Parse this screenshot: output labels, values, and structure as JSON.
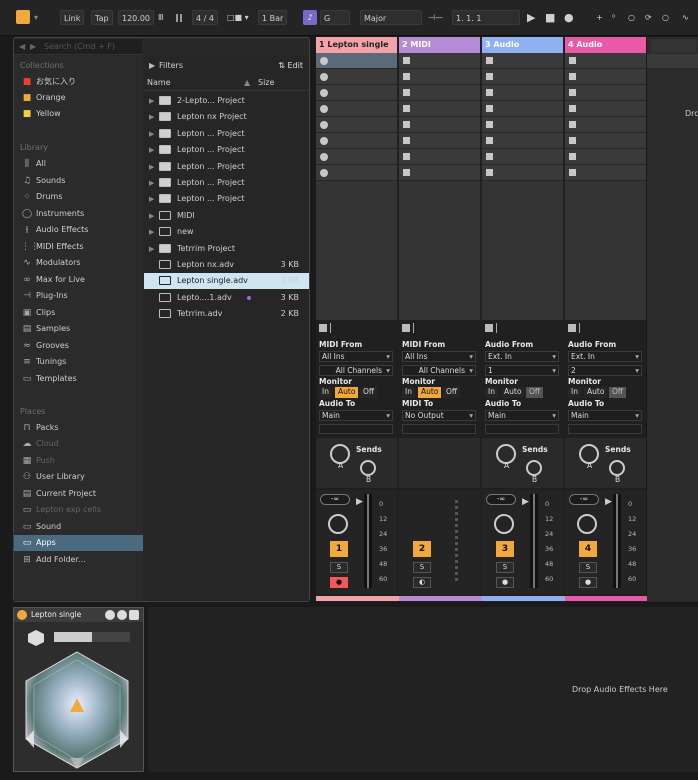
{
  "transport": {
    "link": "Link",
    "tap": "Tap",
    "tempo": "120.00",
    "signature": "4 / 4",
    "quantize": "1 Bar",
    "key": "G",
    "scale": "Major",
    "position": "1.   1.   1"
  },
  "browser": {
    "search_placeholder": "Search (Cmd + F)",
    "filters": "Filters",
    "edit": "Edit",
    "col_name": "Name",
    "col_size": "Size",
    "collections_head": "Collections",
    "collections": [
      {
        "label": "お気に入り",
        "color": "#e8412c"
      },
      {
        "label": "Orange",
        "color": "#f2a83a"
      },
      {
        "label": "Yellow",
        "color": "#f2d23a"
      }
    ],
    "library_head": "Library",
    "library": [
      "All",
      "Sounds",
      "Drums",
      "Instruments",
      "Audio Effects",
      "MIDI Effects",
      "Modulators",
      "Max for Live",
      "Plug-Ins",
      "Clips",
      "Samples",
      "Grooves",
      "Tunings",
      "Templates"
    ],
    "places_head": "Places",
    "places": [
      "Packs",
      "Cloud",
      "Push",
      "User Library",
      "Current Project",
      "Lepton exp cells",
      "Sound",
      "Apps",
      "Add Folder..."
    ],
    "selected_place": "Apps",
    "files": [
      {
        "name": "2-Lepto... Project",
        "size": "",
        "type": "project"
      },
      {
        "name": "Lepton nx Project",
        "size": "",
        "type": "project"
      },
      {
        "name": "Lepton ... Project",
        "size": "",
        "type": "project"
      },
      {
        "name": "Lepton ... Project",
        "size": "",
        "type": "project"
      },
      {
        "name": "Lepton ... Project",
        "size": "",
        "type": "project"
      },
      {
        "name": "Lepton ... Project",
        "size": "",
        "type": "project"
      },
      {
        "name": "Lepton ... Project",
        "size": "",
        "type": "project"
      },
      {
        "name": "MIDI",
        "size": "",
        "type": "folder"
      },
      {
        "name": "new",
        "size": "",
        "type": "folder"
      },
      {
        "name": "Tetrrim Project",
        "size": "",
        "type": "project"
      },
      {
        "name": "Lepton nx.adv",
        "size": "3 KB",
        "type": "file"
      },
      {
        "name": "Lepton single.adv",
        "size": "3 KB",
        "type": "file",
        "selected": true
      },
      {
        "name": "Lepto....1.adv",
        "size": "3 KB",
        "type": "file"
      },
      {
        "name": "Tetrrim.adv",
        "size": "2 KB",
        "type": "file"
      }
    ]
  },
  "tracks": [
    {
      "name": "1 Lepton single",
      "color": "#f3a3a8",
      "num": "1",
      "type": "midi",
      "from_label": "MIDI From",
      "from": "All Ins",
      "channel": "All Channels",
      "monitor": "Auto",
      "to_label": "Audio To",
      "to": "Main",
      "armed": true
    },
    {
      "name": "2 MIDI",
      "color": "#b78ad6",
      "num": "2",
      "type": "midi",
      "from_label": "MIDI From",
      "from": "All Ins",
      "channel": "All Channels",
      "monitor": "Auto",
      "to_label": "MIDI To",
      "to": "No Output",
      "armed": false
    },
    {
      "name": "3 Audio",
      "color": "#8fb1f2",
      "num": "3",
      "type": "audio",
      "from_label": "Audio From",
      "from": "Ext. In",
      "channel": "1",
      "monitor": "Auto",
      "to_label": "Audio To",
      "to": "Main",
      "armed": false
    },
    {
      "name": "4 Audio",
      "color": "#e85aa8",
      "num": "4",
      "type": "audio",
      "from_label": "Audio From",
      "from": "Ext. In",
      "channel": "2",
      "monitor": "Auto",
      "to_label": "Audio To",
      "to": "Main",
      "armed": false
    }
  ],
  "mixer": {
    "monitor_label": "Monitor",
    "monitor_in": "In",
    "monitor_auto": "Auto",
    "monitor_off": "Off",
    "sends": "Sends",
    "send_a": "A",
    "send_b": "B",
    "vol": "-∞",
    "solo": "S",
    "scale": [
      "0",
      "12",
      "24",
      "36",
      "48",
      "60"
    ]
  },
  "right_panel_text": "Drc",
  "device": {
    "name": "Lepton single",
    "drop_text": "Drop Audio Effects Here"
  },
  "colors": {
    "accent": "#f2a83a",
    "selection": "#cfe6f2"
  }
}
